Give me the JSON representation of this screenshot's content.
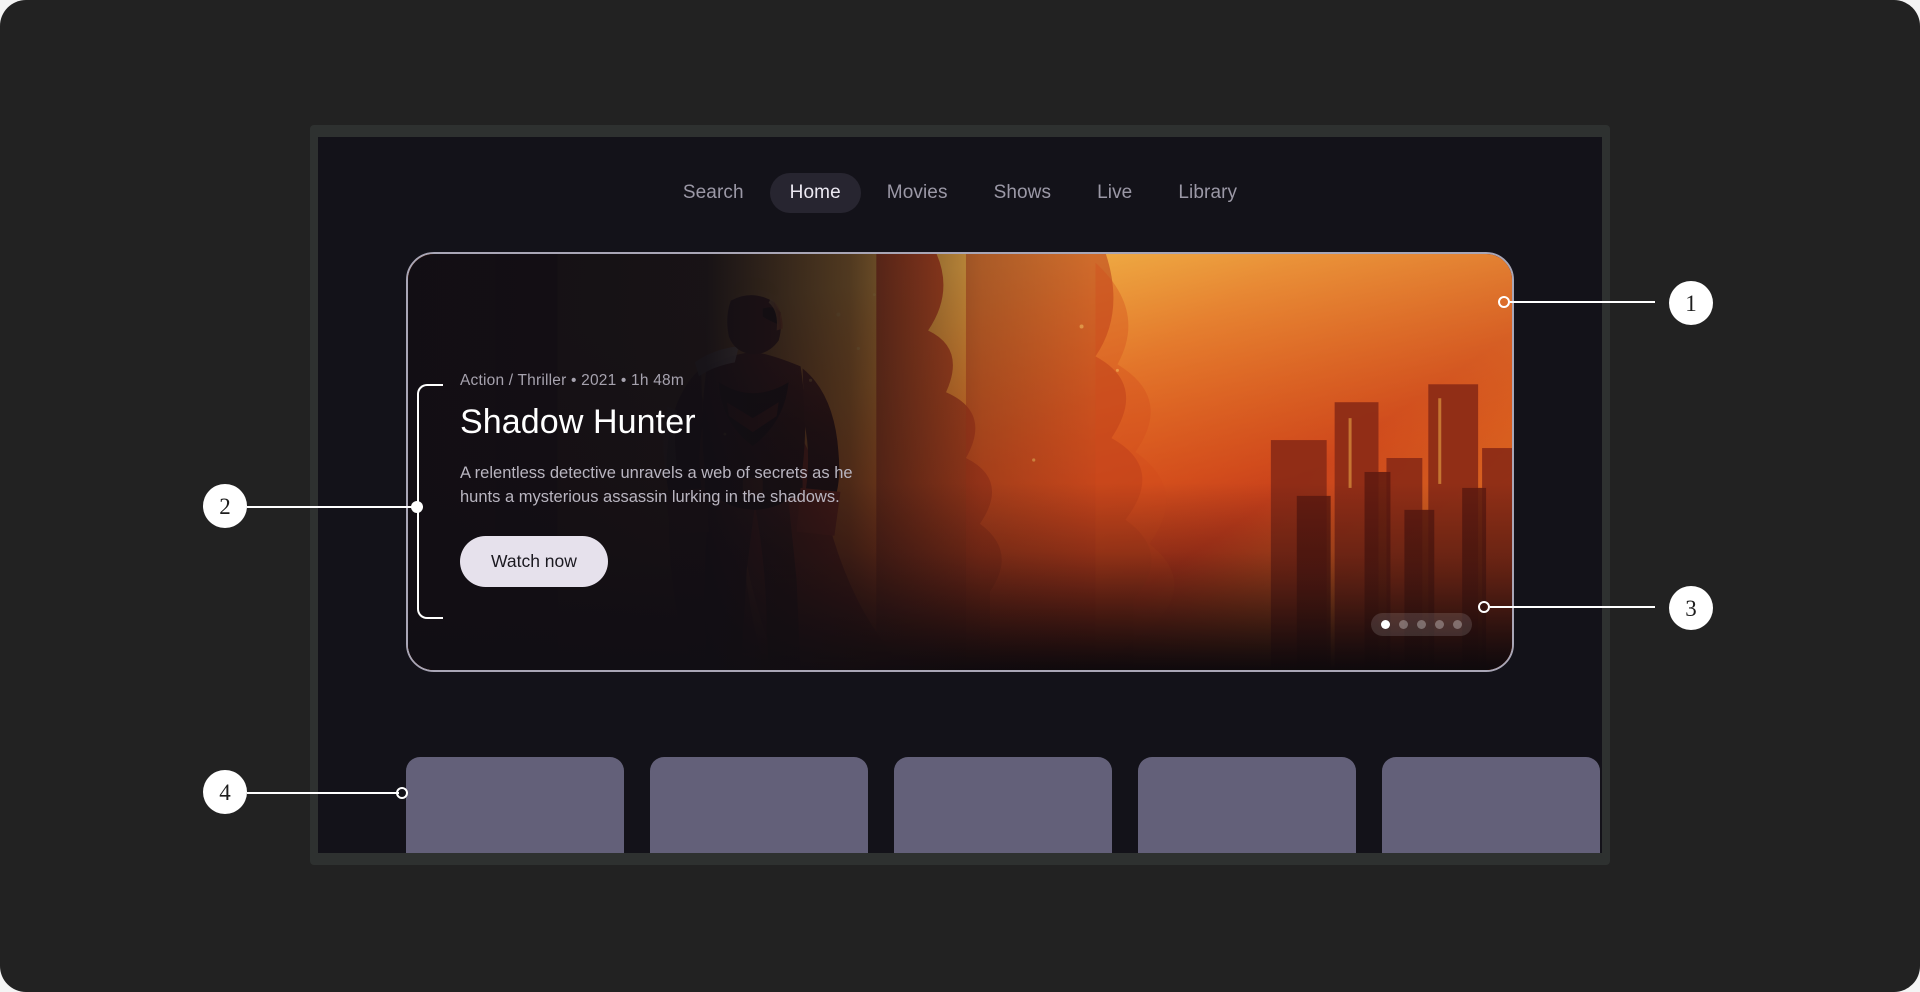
{
  "palette": {
    "page_background": "#222222",
    "device_bezel": "#2e3130",
    "screen_background": "#131219",
    "nav_active_pill": "#272530",
    "nav_text": "#9b98a6",
    "nav_active_text": "#ece9f2",
    "hero_border": "#a9a6b6",
    "button_background": "#e6e1ec",
    "button_text": "#1b1920",
    "card_fill": "#636079",
    "annotation": "#ffffff",
    "art_orange": "#e06a22",
    "art_red": "#c2331a",
    "art_gold": "#e9a83c"
  },
  "nav": {
    "items": [
      {
        "label": "Search",
        "active": false
      },
      {
        "label": "Home",
        "active": true
      },
      {
        "label": "Movies",
        "active": false
      },
      {
        "label": "Shows",
        "active": false
      },
      {
        "label": "Live",
        "active": false
      },
      {
        "label": "Library",
        "active": false
      }
    ]
  },
  "hero": {
    "meta": "Action / Thriller • 2021 • 1h 48m",
    "title": "Shadow Hunter",
    "description": "A relentless detective unravels a web of secrets as he hunts a mysterious assassin lurking in the shadows.",
    "cta_label": "Watch now",
    "carousel": {
      "total": 5,
      "active_index": 0
    },
    "artwork_alt": "Muscular caped hero standing before a burning orange city skyline"
  },
  "rail": {
    "cards": [
      {
        "id": "card-1"
      },
      {
        "id": "card-2"
      },
      {
        "id": "card-3"
      },
      {
        "id": "card-4"
      },
      {
        "id": "card-5"
      }
    ]
  },
  "annotations": [
    {
      "number": "1",
      "target": "hero-card-border"
    },
    {
      "number": "2",
      "target": "hero-copy-block"
    },
    {
      "number": "3",
      "target": "carousel-dots"
    },
    {
      "number": "4",
      "target": "content-rail-card"
    }
  ]
}
